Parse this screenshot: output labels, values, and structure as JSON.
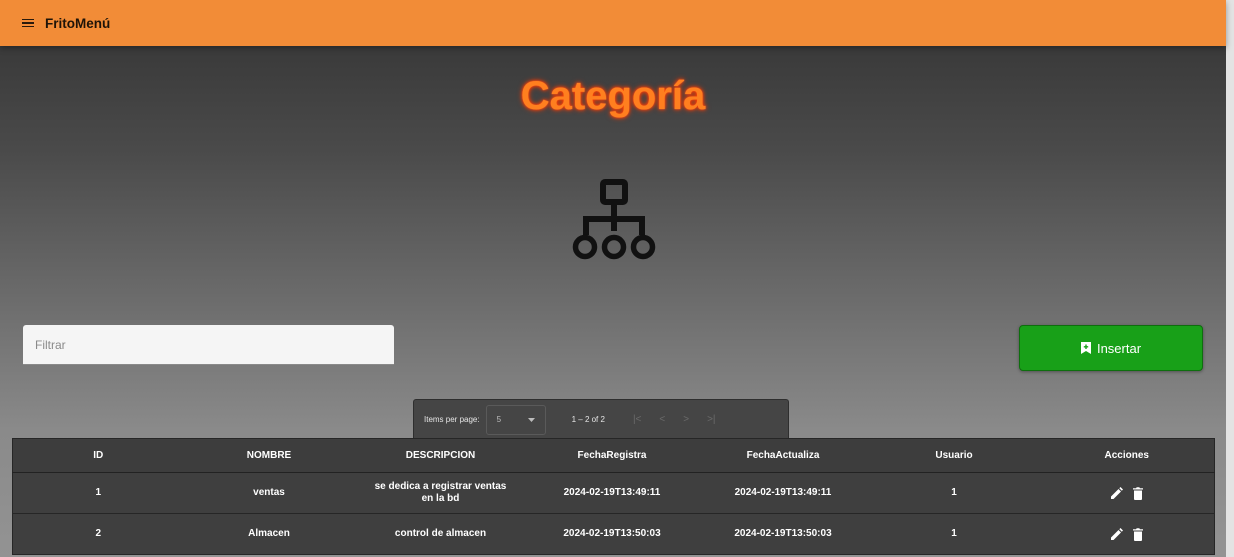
{
  "app": {
    "title": "FritoMenú",
    "menu_icon": "menu-icon"
  },
  "page": {
    "title": "Categoría",
    "hero_icon": "sitemap-icon"
  },
  "filter": {
    "placeholder": "Filtrar",
    "value": ""
  },
  "insert_button": {
    "label": "Insertar",
    "icon": "bookmark-icon",
    "color": "#18a018"
  },
  "paginator": {
    "items_per_page_label": "Items per page:",
    "page_size": "5",
    "range_label": "1 – 2 of 2",
    "nav_icons": [
      "first-page-icon",
      "previous-page-icon",
      "next-page-icon",
      "last-page-icon"
    ]
  },
  "table": {
    "columns": [
      "ID",
      "NOMBRE",
      "DESCRIPCION",
      "FechaRegistra",
      "FechaActualiza",
      "Usuario",
      "Acciones"
    ],
    "rows": [
      {
        "id": "1",
        "nombre": "ventas",
        "descripcion": "se dedica a registrar ventas en la bd",
        "fecha_registra": "2024-02-19T13:49:11",
        "fecha_actualiza": "2024-02-19T13:49:11",
        "usuario": "1"
      },
      {
        "id": "2",
        "nombre": "Almacen",
        "descripcion": "control de almacen",
        "fecha_registra": "2024-02-19T13:50:03",
        "fecha_actualiza": "2024-02-19T13:50:03",
        "usuario": "1"
      }
    ],
    "row_actions": [
      "edit-icon",
      "delete-icon"
    ]
  },
  "colors": {
    "toolbar": "#f28c37",
    "title": "#ff7f1f",
    "title_glow": "#ff3b00",
    "insert": "#18a018"
  }
}
